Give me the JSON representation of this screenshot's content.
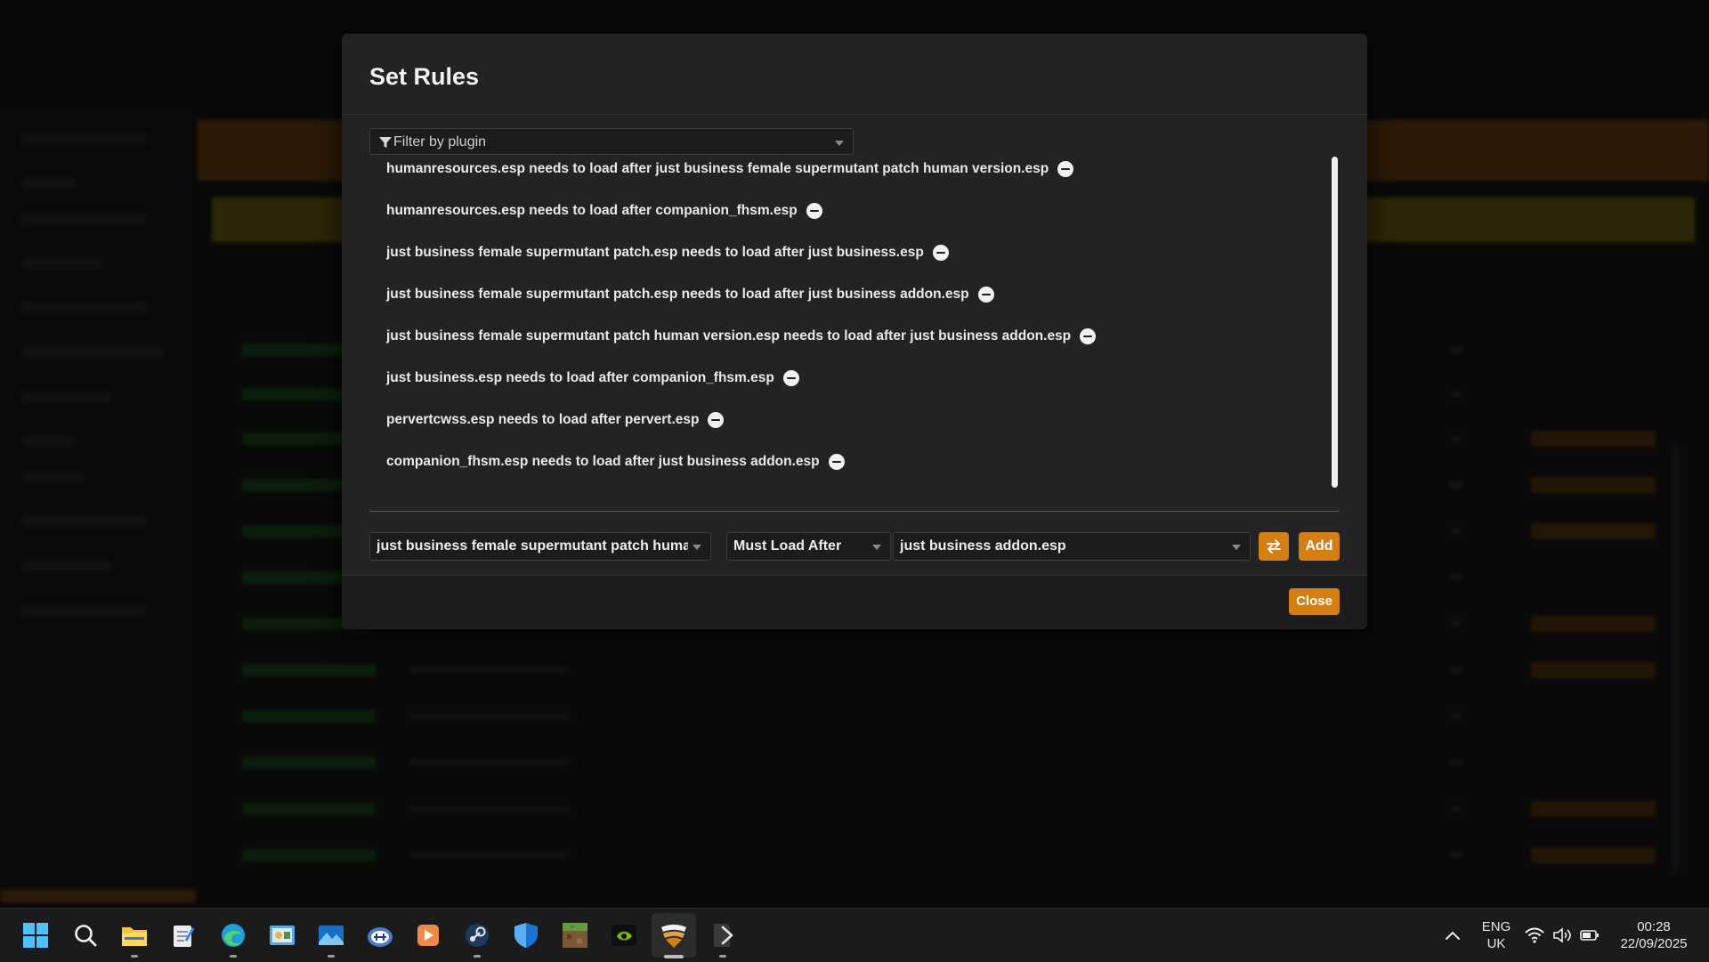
{
  "modal": {
    "title": "Set Rules",
    "filter_placeholder": "Filter by plugin",
    "rules": [
      "humanresources.esp needs to load after just business female supermutant patch human version.esp",
      "humanresources.esp needs to load after companion_fhsm.esp",
      "just business female supermutant patch.esp needs to load after just business.esp",
      "just business female supermutant patch.esp needs to load after just business addon.esp",
      "just business female supermutant patch human version.esp needs to load after just business addon.esp",
      "just business.esp needs to load after companion_fhsm.esp",
      "pervertcwss.esp needs to load after pervert.esp",
      "companion_fhsm.esp needs to load after just business addon.esp"
    ],
    "source_plugin": "just business female supermutant patch human version.esp",
    "rule_type": "Must Load After",
    "target_plugin": "just business addon.esp",
    "add_label": "Add",
    "close_label": "Close",
    "accent_color": "#d47f14"
  },
  "taskbar": {
    "icons": [
      "windows-start-icon",
      "search-icon",
      "file-explorer-icon",
      "notepad-icon",
      "edge-browser-icon",
      "control-panel-icon",
      "photos-icon",
      "app-icon",
      "media-player-icon",
      "steam-icon",
      "windows-security-icon",
      "minecraft-icon",
      "nvidia-icon",
      "mod-manager-icon",
      "terminal-icon"
    ],
    "language": "ENG",
    "region": "UK",
    "time": "00:28",
    "date": "22/09/2025"
  }
}
